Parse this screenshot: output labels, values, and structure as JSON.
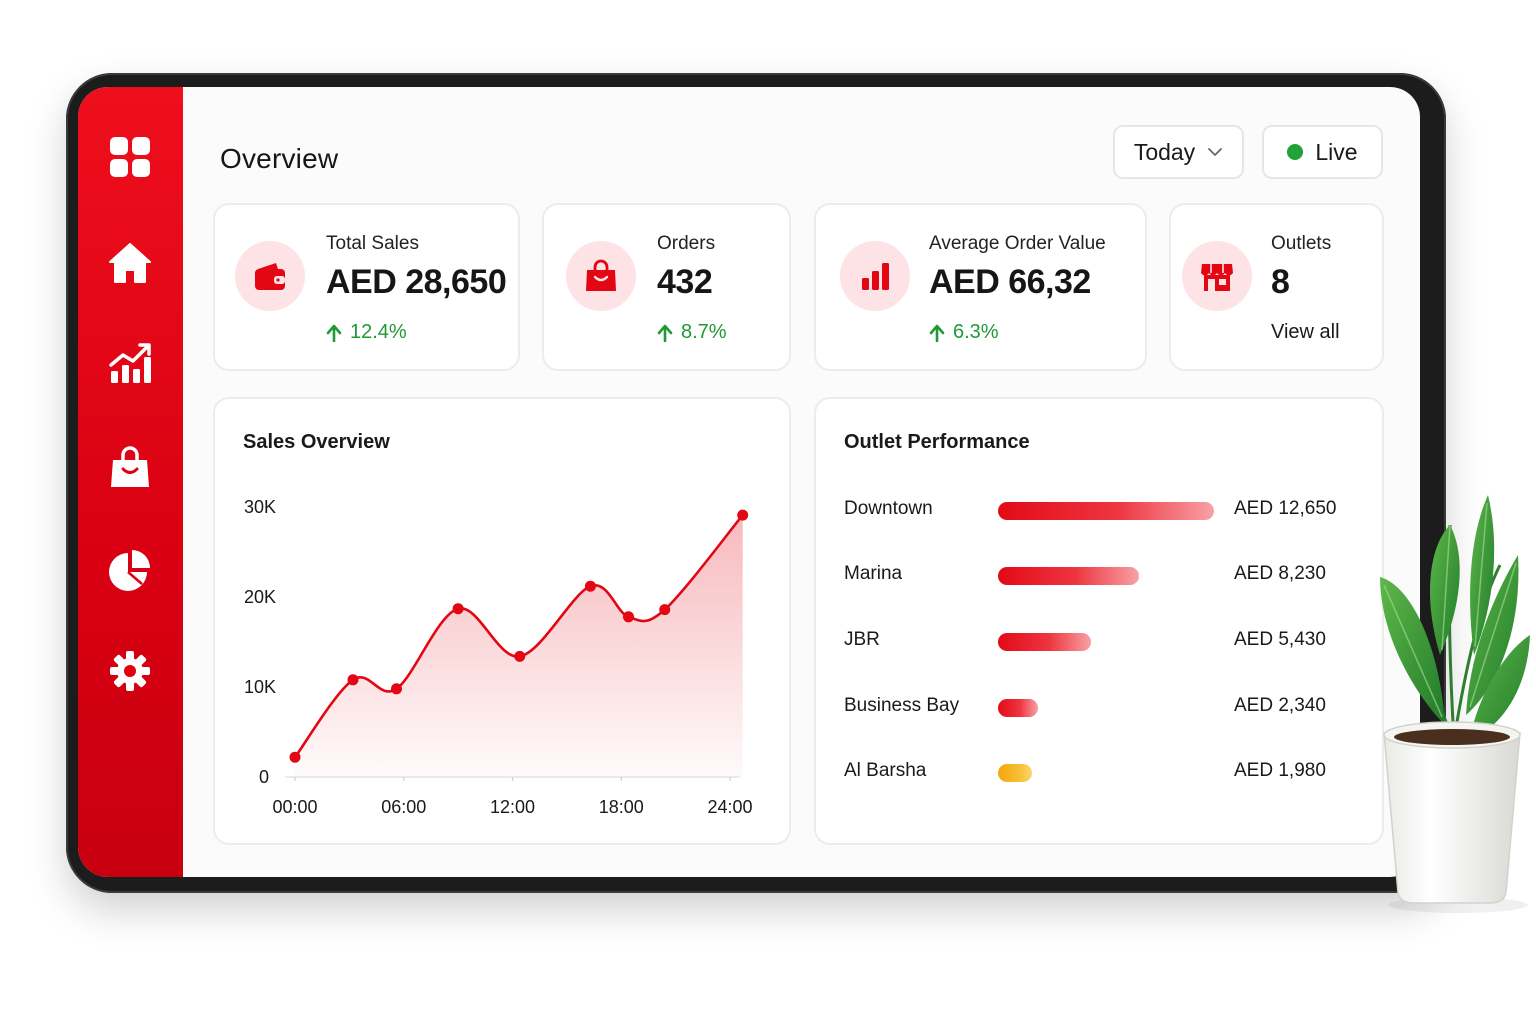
{
  "header": {
    "title": "Overview",
    "range_label": "Today",
    "live_label": "Live"
  },
  "sidebar": {
    "items": [
      {
        "icon": "dashboard-grid-icon"
      },
      {
        "icon": "home-icon"
      },
      {
        "icon": "analytics-icon"
      },
      {
        "icon": "shopping-bag-icon"
      },
      {
        "icon": "pie-chart-icon"
      },
      {
        "icon": "settings-gear-icon"
      }
    ]
  },
  "stats": [
    {
      "label": "Total Sales",
      "value": "AED 28,650",
      "delta": "12.4%",
      "icon": "wallet-icon"
    },
    {
      "label": "Orders",
      "value": "432",
      "delta": "8.7%",
      "icon": "shopping-bag-icon"
    },
    {
      "label": "Average Order Value",
      "value": "AED 66,32",
      "delta": "6.3%",
      "icon": "bar-chart-icon"
    },
    {
      "label": "Outlets",
      "value": "8",
      "link": "View all",
      "icon": "storefront-icon"
    }
  ],
  "sales_overview": {
    "title": "Sales Overview"
  },
  "chart_data": {
    "type": "line",
    "title": "Sales Overview",
    "x_ticks": [
      "00:00",
      "06:00",
      "12:00",
      "18:00",
      "24:00"
    ],
    "y_ticks": [
      "0",
      "10K",
      "20K",
      "30K"
    ],
    "ylim": [
      0,
      30000
    ],
    "xlim": [
      0,
      24
    ],
    "x": [
      0,
      3.2,
      5.6,
      9,
      12.4,
      16.3,
      18.4,
      20.4,
      24.7
    ],
    "y": [
      2200,
      10800,
      9800,
      18700,
      13400,
      21200,
      17800,
      18600,
      29100
    ],
    "color": "#e30613",
    "fill": "area-gradient",
    "markers": true,
    "grid": false
  },
  "outlet_performance": {
    "title": "Outlet Performance",
    "max_value": 12650,
    "items": [
      {
        "name": "Downtown",
        "value": 12650,
        "label": "AED 12,650",
        "color": "red"
      },
      {
        "name": "Marina",
        "value": 8230,
        "label": "AED 8,230",
        "color": "red"
      },
      {
        "name": "JBR",
        "value": 5430,
        "label": "AED 5,430",
        "color": "red"
      },
      {
        "name": "Business Bay",
        "value": 2340,
        "label": "AED 2,340",
        "color": "red"
      },
      {
        "name": "Al Barsha",
        "value": 1980,
        "label": "AED 1,980",
        "color": "amber"
      }
    ]
  },
  "colors": {
    "brand_red": "#e30613",
    "positive_green": "#1f9a36",
    "live_green": "#22a33a",
    "amber": "#f5a60c"
  }
}
